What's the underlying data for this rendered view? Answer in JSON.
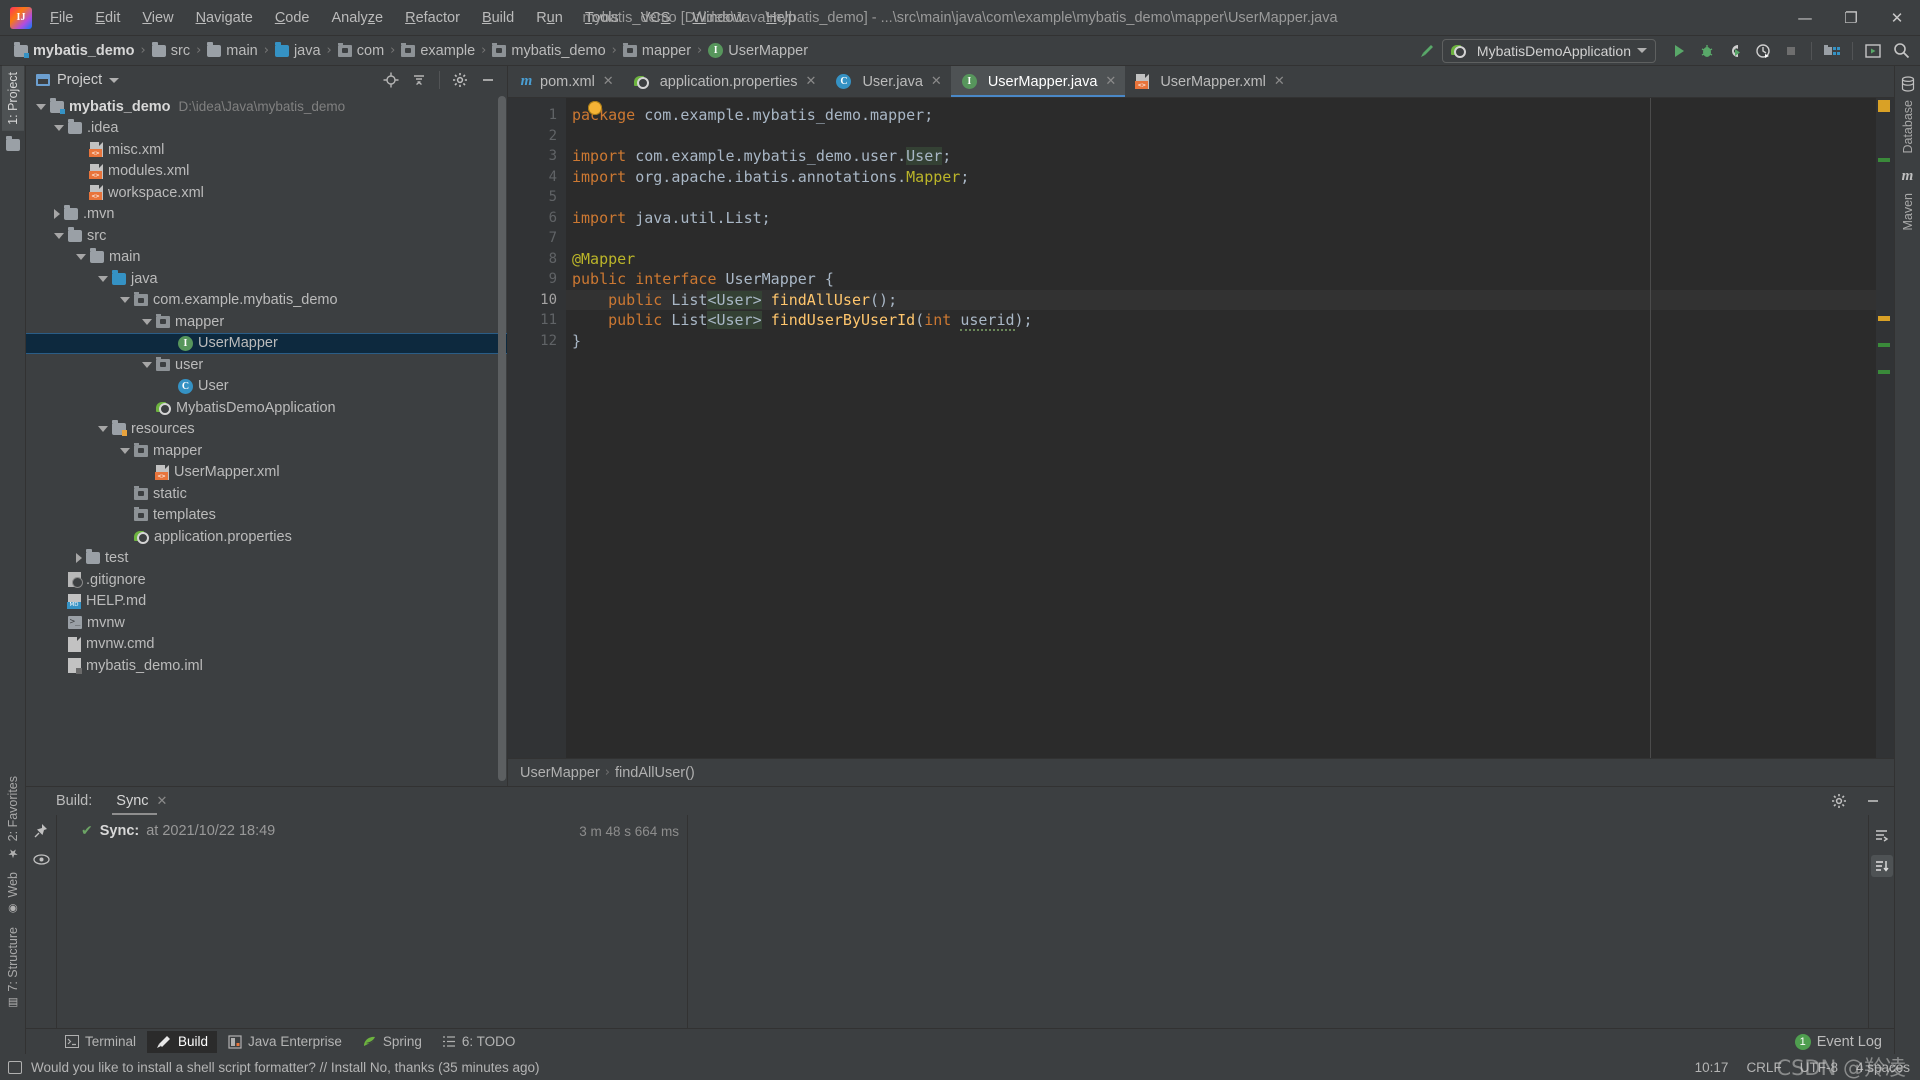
{
  "window": {
    "title": "mybatis_demo [D:\\idea\\Java\\mybatis_demo] - ...\\src\\main\\java\\com\\example\\mybatis_demo\\mapper\\UserMapper.java",
    "minimize": "—",
    "maximize": "❐",
    "close": "✕"
  },
  "menubar": {
    "items": [
      {
        "label": "File"
      },
      {
        "label": "Edit"
      },
      {
        "label": "View"
      },
      {
        "label": "Navigate"
      },
      {
        "label": "Code"
      },
      {
        "label": "Analyze"
      },
      {
        "label": "Refactor"
      },
      {
        "label": "Build"
      },
      {
        "label": "Run"
      },
      {
        "label": "Tools"
      },
      {
        "label": "VCS"
      },
      {
        "label": "Window"
      },
      {
        "label": "Help"
      }
    ]
  },
  "navbar": {
    "crumbs": [
      {
        "label": "mybatis_demo",
        "icon": "module-folder-icon"
      },
      {
        "label": "src",
        "icon": "folder-icon"
      },
      {
        "label": "main",
        "icon": "folder-icon"
      },
      {
        "label": "java",
        "icon": "source-folder-icon"
      },
      {
        "label": "com",
        "icon": "package-icon"
      },
      {
        "label": "example",
        "icon": "package-icon"
      },
      {
        "label": "mybatis_demo",
        "icon": "package-icon"
      },
      {
        "label": "mapper",
        "icon": "package-icon"
      },
      {
        "label": "UserMapper",
        "icon": "interface-icon"
      }
    ],
    "separator": "›",
    "run_config": "MybatisDemoApplication",
    "toolbar_icons": [
      "build-hammer-icon",
      "run-icon",
      "debug-icon",
      "run-coverage-icon",
      "profiler-icon",
      "stop-icon",
      "project-structure-icon",
      "update-app-icon",
      "search-icon"
    ]
  },
  "left_strip": {
    "tabs": [
      {
        "label": "1: Project",
        "active": true
      },
      {
        "label": "2: Favorites",
        "active": false
      },
      {
        "label": "Web",
        "active": false
      },
      {
        "label": "7: Structure",
        "active": false
      }
    ]
  },
  "right_strip": {
    "tabs": [
      {
        "label": "Database",
        "active": false
      },
      {
        "label": "Maven",
        "active": false
      }
    ]
  },
  "project_panel": {
    "title": "Project",
    "dropdown_caret": "▾",
    "actions": [
      "locate-icon",
      "collapse-all-icon",
      "settings-gear-icon",
      "hide-icon"
    ],
    "tree": [
      {
        "depth": 0,
        "label": "mybatis_demo",
        "path": "D:\\idea\\Java\\mybatis_demo",
        "icon": "module-folder-icon",
        "twist": "open",
        "bold": true
      },
      {
        "depth": 1,
        "label": ".idea",
        "icon": "folder-icon",
        "twist": "open"
      },
      {
        "depth": 2,
        "label": "misc.xml",
        "icon": "xml-file-icon",
        "twist": "none"
      },
      {
        "depth": 2,
        "label": "modules.xml",
        "icon": "xml-file-icon",
        "twist": "none"
      },
      {
        "depth": 2,
        "label": "workspace.xml",
        "icon": "xml-file-icon",
        "twist": "none"
      },
      {
        "depth": 1,
        "label": ".mvn",
        "icon": "folder-icon",
        "twist": "closed"
      },
      {
        "depth": 1,
        "label": "src",
        "icon": "folder-icon",
        "twist": "open"
      },
      {
        "depth": 2,
        "label": "main",
        "icon": "folder-icon",
        "twist": "open"
      },
      {
        "depth": 3,
        "label": "java",
        "icon": "source-folder-icon",
        "twist": "open"
      },
      {
        "depth": 4,
        "label": "com.example.mybatis_demo",
        "icon": "package-icon",
        "twist": "open"
      },
      {
        "depth": 5,
        "label": "mapper",
        "icon": "package-icon",
        "twist": "open"
      },
      {
        "depth": 6,
        "label": "UserMapper",
        "icon": "interface-icon",
        "twist": "none",
        "selected": true
      },
      {
        "depth": 5,
        "label": "user",
        "icon": "package-icon",
        "twist": "open"
      },
      {
        "depth": 6,
        "label": "User",
        "icon": "class-icon",
        "twist": "none"
      },
      {
        "depth": 5,
        "label": "MybatisDemoApplication",
        "icon": "spring-boot-icon",
        "twist": "none"
      },
      {
        "depth": 3,
        "label": "resources",
        "icon": "resources-folder-icon",
        "twist": "open"
      },
      {
        "depth": 4,
        "label": "mapper",
        "icon": "package-icon",
        "twist": "open"
      },
      {
        "depth": 5,
        "label": "UserMapper.xml",
        "icon": "xml-file-icon",
        "twist": "none"
      },
      {
        "depth": 4,
        "label": "static",
        "icon": "package-icon",
        "twist": "none"
      },
      {
        "depth": 4,
        "label": "templates",
        "icon": "package-icon",
        "twist": "none"
      },
      {
        "depth": 4,
        "label": "application.properties",
        "icon": "spring-properties-icon",
        "twist": "none"
      },
      {
        "depth": 2,
        "label": "test",
        "icon": "folder-icon",
        "twist": "closed"
      },
      {
        "depth": 1,
        "label": ".gitignore",
        "icon": "gitignore-icon",
        "twist": "none"
      },
      {
        "depth": 1,
        "label": "HELP.md",
        "icon": "markdown-icon",
        "twist": "none"
      },
      {
        "depth": 1,
        "label": "mvnw",
        "icon": "shell-script-icon",
        "twist": "none"
      },
      {
        "depth": 1,
        "label": "mvnw.cmd",
        "icon": "file-icon",
        "twist": "none"
      },
      {
        "depth": 1,
        "label": "mybatis_demo.iml",
        "icon": "iml-file-icon",
        "twist": "none"
      }
    ]
  },
  "editor": {
    "tabs": [
      {
        "label": "pom.xml",
        "icon": "maven-icon",
        "active": false,
        "close": "✕"
      },
      {
        "label": "application.properties",
        "icon": "spring-properties-icon",
        "active": false,
        "close": "✕"
      },
      {
        "label": "User.java",
        "icon": "class-icon",
        "active": false,
        "close": "✕"
      },
      {
        "label": "UserMapper.java",
        "icon": "interface-icon",
        "active": true,
        "close": "✕"
      },
      {
        "label": "UserMapper.xml",
        "icon": "xml-file-icon",
        "active": false,
        "close": "✕"
      }
    ],
    "line_numbers": [
      "1",
      "2",
      "3",
      "4",
      "5",
      "6",
      "7",
      "8",
      "9",
      "10",
      "11",
      "12"
    ],
    "code_lines": [
      {
        "n": 1,
        "text": "package com.example.mybatis_demo.mapper;"
      },
      {
        "n": 2,
        "text": ""
      },
      {
        "n": 3,
        "text": "import com.example.mybatis_demo.user.User;",
        "fold": "−"
      },
      {
        "n": 4,
        "text": "import org.apache.ibatis.annotations.Mapper;"
      },
      {
        "n": 5,
        "text": ""
      },
      {
        "n": 6,
        "text": "import java.util.List;",
        "fold": "−"
      },
      {
        "n": 7,
        "text": ""
      },
      {
        "n": 8,
        "text": "@Mapper"
      },
      {
        "n": 9,
        "text": "public interface UserMapper {"
      },
      {
        "n": 10,
        "text": "    public List<User> findAllUser();",
        "highlight": true
      },
      {
        "n": 11,
        "text": "    public List<User> findUserByUserId(int userid);"
      },
      {
        "n": 12,
        "text": "}"
      }
    ],
    "breadcrumb": {
      "class": "UserMapper",
      "separator": "›",
      "member": "findAllUser()"
    }
  },
  "build_panel": {
    "label": "Build:",
    "tab": "Sync",
    "tab_close": "✕",
    "actions": [
      "settings-gear-icon",
      "hide-icon"
    ],
    "rows": [
      {
        "status": "✔",
        "title": "Sync:",
        "detail": "at 2021/10/22 18:49",
        "duration": "3 m 48 s 664 ms"
      }
    ],
    "right_icons": [
      "show-as-tree-icon",
      "sort-icon"
    ]
  },
  "tool_windows": {
    "tabs": [
      {
        "label": "Terminal",
        "icon": "terminal-icon",
        "active": false
      },
      {
        "label": "Build",
        "icon": "build-hammer-icon",
        "active": true
      },
      {
        "label": "Java Enterprise",
        "icon": "java-enterprise-icon",
        "active": false
      },
      {
        "label": "Spring",
        "icon": "spring-icon",
        "active": false
      },
      {
        "label": "6: TODO",
        "icon": "todo-icon",
        "active": false
      }
    ],
    "event_log": {
      "count": "1",
      "label": "Event Log"
    }
  },
  "statusbar": {
    "message": "Would you like to install a shell script formatter? // Install   No, thanks (35 minutes ago)",
    "position": "10:17",
    "line_separator": "CRLF",
    "encoding": "UTF-8",
    "indent": "4 spaces",
    "watermark": "CSDN @羚凌"
  },
  "colors": {
    "accent_blue": "#4a88c7",
    "selection": "#0d293e",
    "keyword_orange": "#cc7832",
    "method_yellow": "#ffc66d",
    "annotation_olive": "#bbb529",
    "green_run": "#59a869",
    "editor_bg": "#2b2b2b",
    "panel_bg": "#3c3f41"
  }
}
